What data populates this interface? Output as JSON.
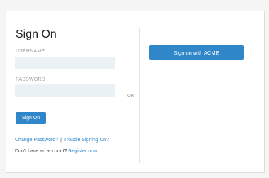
{
  "login": {
    "title": "Sign On",
    "username_label": "USERNAME",
    "username_value": "",
    "password_label": "PASSWORD",
    "password_value": "",
    "sign_on_button": "Sign On",
    "change_password_link": "Change Password?",
    "separator": "|",
    "trouble_link": "Trouble Signing On?",
    "no_account_text": "Don't have an account?",
    "register_link": "Register now"
  },
  "divider": {
    "or_text": "OR"
  },
  "sso": {
    "button_label": "Sign on with ACME"
  },
  "colors": {
    "accent": "#2f86c9",
    "input_bg": "#ebf2f5",
    "page_bg": "#f5f5f5"
  }
}
